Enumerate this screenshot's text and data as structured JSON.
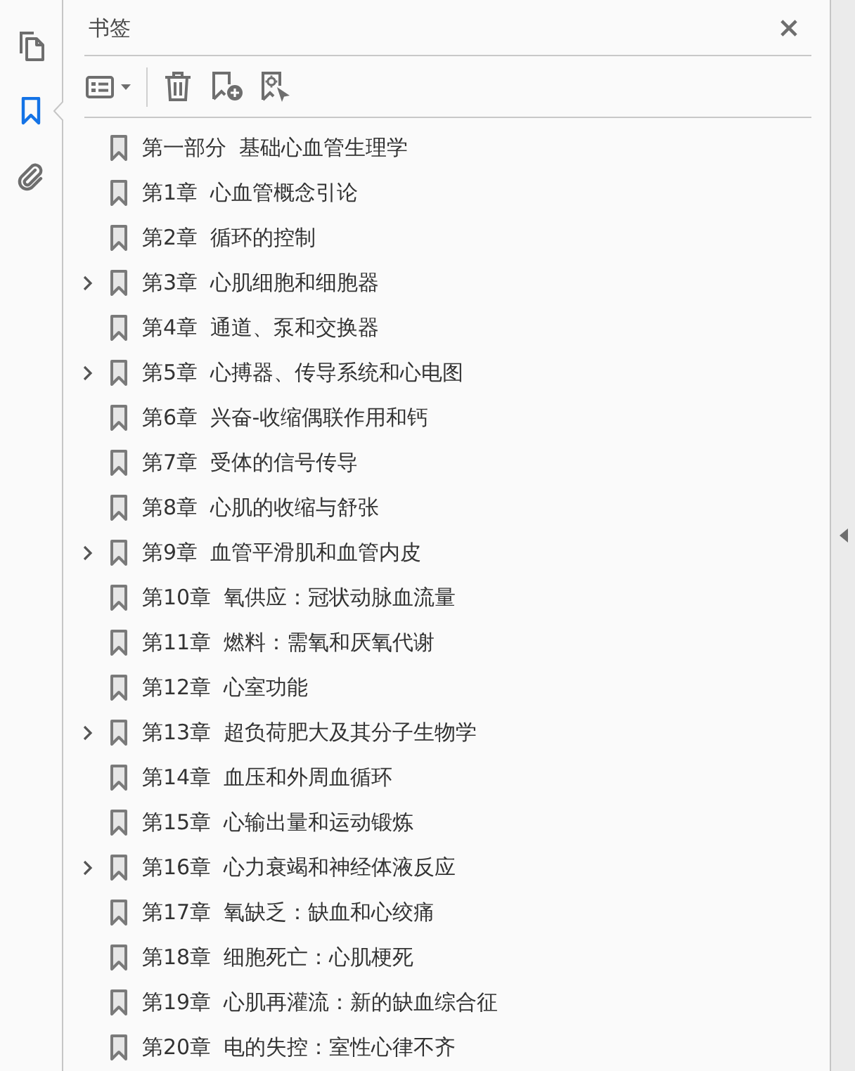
{
  "side_rail": {
    "tabs": [
      {
        "kind": "pages",
        "selected": false
      },
      {
        "kind": "bookmarks",
        "selected": true
      },
      {
        "kind": "attachments",
        "selected": false
      }
    ]
  },
  "panel": {
    "title": "书签"
  },
  "bookmarks": [
    {
      "kind": "leaf",
      "label": "第一部分 基础心血管生理学"
    },
    {
      "kind": "leaf",
      "label": "第1章 心血管概念引论"
    },
    {
      "kind": "leaf",
      "label": "第2章 循环的控制"
    },
    {
      "kind": "branch",
      "expanded": false,
      "label": "第3章 心肌细胞和细胞器"
    },
    {
      "kind": "leaf",
      "label": "第4章 通道、泵和交换器"
    },
    {
      "kind": "branch",
      "expanded": false,
      "label": "第5章 心搏器、传导系统和心电图"
    },
    {
      "kind": "leaf",
      "label": "第6章 兴奋-收缩偶联作用和钙"
    },
    {
      "kind": "leaf",
      "label": "第7章 受体的信号传导"
    },
    {
      "kind": "leaf",
      "label": "第8章 心肌的收缩与舒张"
    },
    {
      "kind": "branch",
      "expanded": false,
      "label": "第9章 血管平滑肌和血管内皮"
    },
    {
      "kind": "leaf",
      "label": "第10章 氧供应：冠状动脉血流量"
    },
    {
      "kind": "leaf",
      "label": "第11章 燃料：需氧和厌氧代谢"
    },
    {
      "kind": "leaf",
      "label": "第12章 心室功能"
    },
    {
      "kind": "branch",
      "expanded": false,
      "label": "第13章 超负荷肥大及其分子生物学"
    },
    {
      "kind": "leaf",
      "label": "第14章 血压和外周血循环"
    },
    {
      "kind": "leaf",
      "label": "第15章 心输出量和运动锻炼"
    },
    {
      "kind": "branch",
      "expanded": false,
      "label": "第16章 心力衰竭和神经体液反应"
    },
    {
      "kind": "leaf",
      "label": "第17章 氧缺乏：缺血和心绞痛"
    },
    {
      "kind": "leaf",
      "label": "第18章 细胞死亡：心肌梗死"
    },
    {
      "kind": "leaf",
      "label": "第19章 心肌再灌流：新的缺血综合征"
    },
    {
      "kind": "leaf",
      "label": "第20章 电的失控：室性心律不齐"
    }
  ]
}
